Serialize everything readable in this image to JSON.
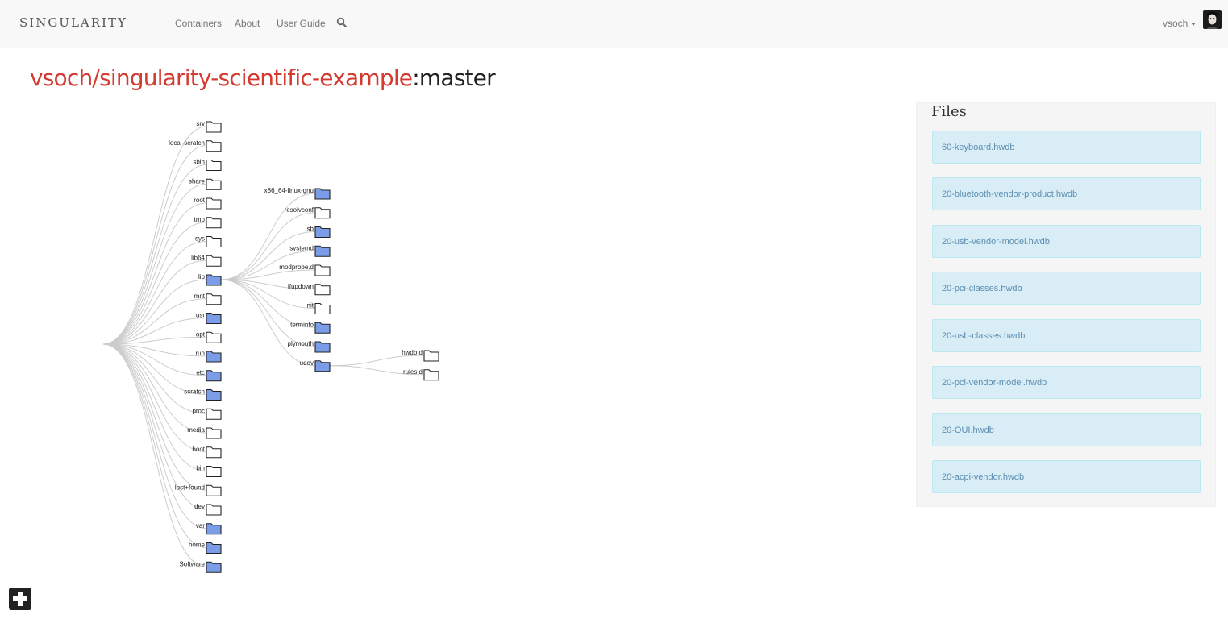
{
  "navbar": {
    "brand": "SINGULARITY",
    "links": [
      "Containers",
      "About",
      "User Guide"
    ],
    "username": "vsoch",
    "icons": {
      "search": "search-icon",
      "avatar": "avatar-image",
      "add": "plus-icon"
    }
  },
  "page": {
    "container_name": "vsoch/singularity-scientific-example",
    "separator": ":",
    "tag": "master"
  },
  "tree": {
    "level1": [
      {
        "name": "srv",
        "has_children": false
      },
      {
        "name": "local-scratch",
        "has_children": false
      },
      {
        "name": "sbin",
        "has_children": false
      },
      {
        "name": "share",
        "has_children": false
      },
      {
        "name": "root",
        "has_children": false
      },
      {
        "name": "tmp",
        "has_children": false
      },
      {
        "name": "sys",
        "has_children": false
      },
      {
        "name": "lib64",
        "has_children": false
      },
      {
        "name": "lib",
        "has_children": true
      },
      {
        "name": "mnt",
        "has_children": false
      },
      {
        "name": "usr",
        "has_children": true
      },
      {
        "name": "opt",
        "has_children": false
      },
      {
        "name": "run",
        "has_children": true
      },
      {
        "name": "etc",
        "has_children": true
      },
      {
        "name": "scratch",
        "has_children": true
      },
      {
        "name": "proc",
        "has_children": false
      },
      {
        "name": "media",
        "has_children": false
      },
      {
        "name": "boot",
        "has_children": false
      },
      {
        "name": "bin",
        "has_children": false
      },
      {
        "name": "lost+found",
        "has_children": false
      },
      {
        "name": "dev",
        "has_children": false
      },
      {
        "name": "var",
        "has_children": true
      },
      {
        "name": "home",
        "has_children": true
      },
      {
        "name": "Software",
        "has_children": true
      }
    ],
    "level2": [
      {
        "name": "x86_64-linux-gnu",
        "has_children": true
      },
      {
        "name": "resolvconf",
        "has_children": false
      },
      {
        "name": "lsb",
        "has_children": true
      },
      {
        "name": "systemd",
        "has_children": true
      },
      {
        "name": "modprobe.d",
        "has_children": false
      },
      {
        "name": "ifupdown",
        "has_children": false
      },
      {
        "name": "init",
        "has_children": false
      },
      {
        "name": "terminfo",
        "has_children": true
      },
      {
        "name": "plymouth",
        "has_children": true
      },
      {
        "name": "udev",
        "has_children": true
      }
    ],
    "level3": [
      {
        "name": "hwdb.d",
        "has_children": false
      },
      {
        "name": "rules.d",
        "has_children": false
      }
    ]
  },
  "files_panel": {
    "title": "Files",
    "files": [
      "60-keyboard.hwdb",
      "20-bluetooth-vendor-product.hwdb",
      "20-usb-vendor-model.hwdb",
      "20-pci-classes.hwdb",
      "20-usb-classes.hwdb",
      "20-pci-vendor-model.hwdb",
      "20-OUI.hwdb",
      "20-acpi-vendor.hwdb"
    ]
  },
  "colors": {
    "title_red": "#d43b30",
    "folder_blue": "#7b9de8",
    "file_bg": "#d9edf7",
    "file_text": "#5b8db0"
  }
}
